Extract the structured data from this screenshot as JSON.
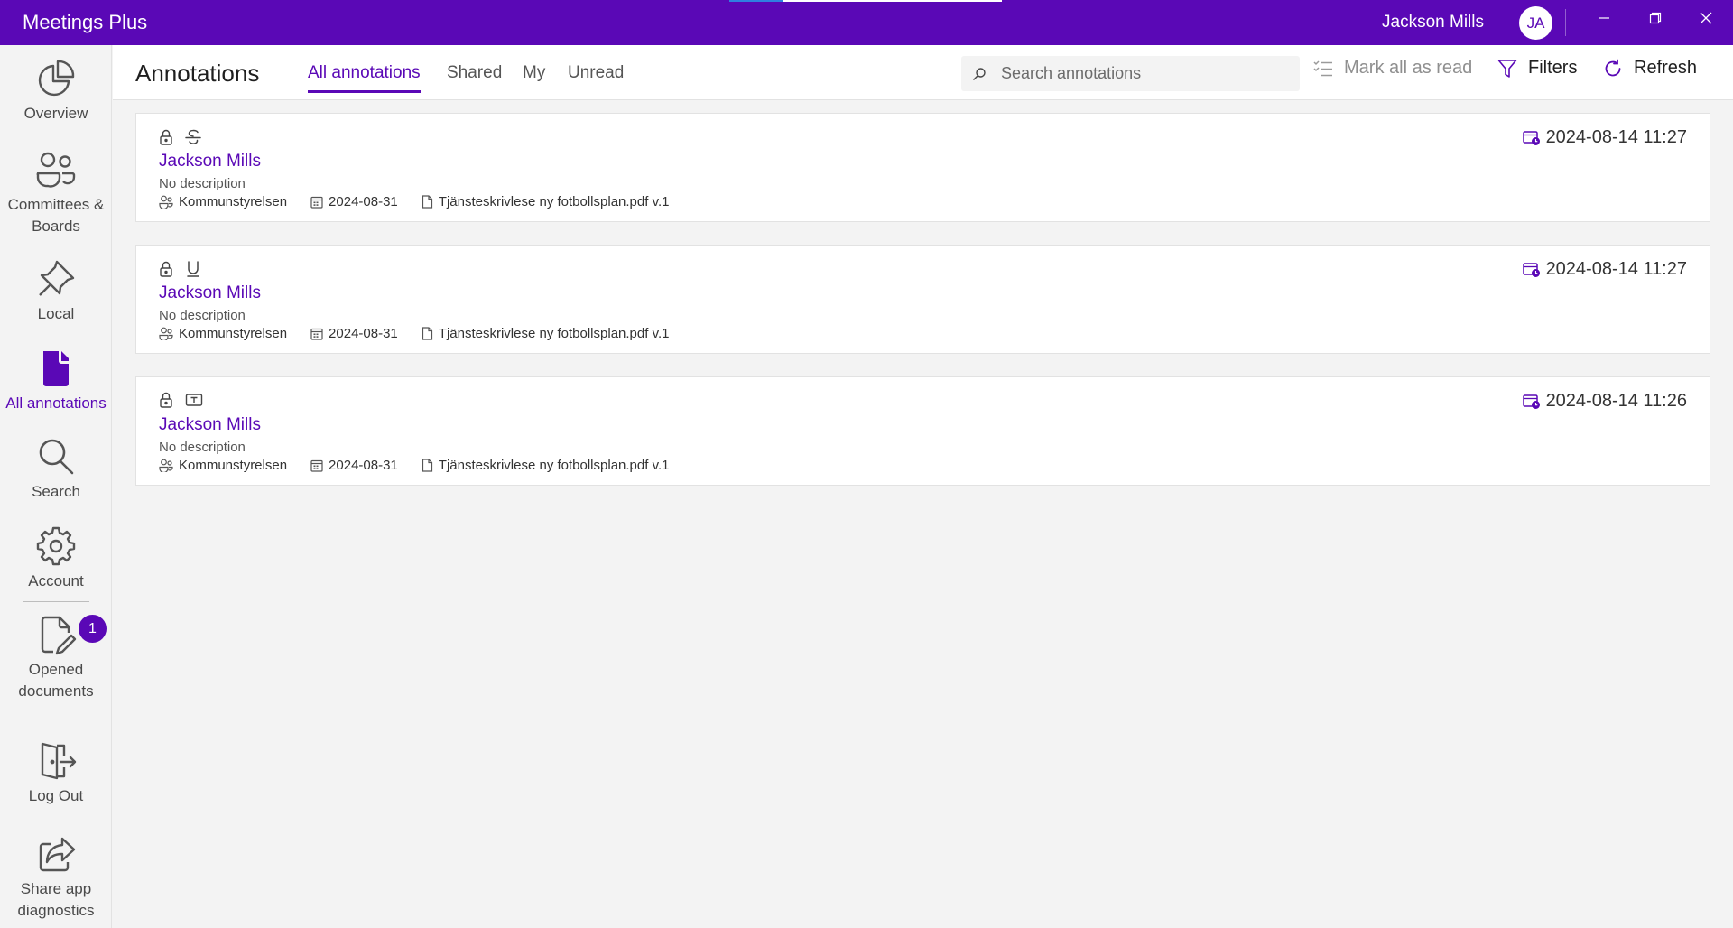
{
  "app": {
    "title": "Meetings Plus"
  },
  "user": {
    "name": "Jackson Mills",
    "initials": "JA"
  },
  "colors": {
    "accent": "#5a08b6",
    "background": "#f3f3f3",
    "card": "#ffffff"
  },
  "sidebar": {
    "items": [
      {
        "label": "Overview",
        "icon": "pie-chart-icon"
      },
      {
        "label": "Committees & Boards",
        "icon": "people-icon"
      },
      {
        "label": "Local",
        "icon": "pin-icon"
      },
      {
        "label": "All annotations",
        "icon": "document-icon",
        "active": true
      },
      {
        "label": "Search",
        "icon": "search-icon"
      },
      {
        "label": "Account",
        "icon": "gear-icon"
      },
      {
        "label": "Opened documents",
        "icon": "document-edit-icon",
        "badge": "1"
      },
      {
        "label": "Log Out",
        "icon": "logout-icon"
      },
      {
        "label": "Share app diagnostics",
        "icon": "share-icon"
      }
    ]
  },
  "header": {
    "title": "Annotations",
    "tabs": [
      {
        "label": "All annotations",
        "active": true
      },
      {
        "label": "Shared"
      },
      {
        "label": "My"
      },
      {
        "label": "Unread"
      }
    ],
    "search_placeholder": "Search annotations",
    "mark_all_label": "Mark all as read",
    "filters_label": "Filters",
    "refresh_label": "Refresh"
  },
  "annotations": [
    {
      "type_icon": "strikethrough-icon",
      "author": "Jackson Mills",
      "description": "No description",
      "committee": "Kommunstyrelsen",
      "meeting_date": "2024-08-31",
      "document": "Tjänsteskrivlese ny fotbollsplan.pdf v.1",
      "timestamp": "2024-08-14 11:27"
    },
    {
      "type_icon": "underline-icon",
      "author": "Jackson Mills",
      "description": "No description",
      "committee": "Kommunstyrelsen",
      "meeting_date": "2024-08-31",
      "document": "Tjänsteskrivlese ny fotbollsplan.pdf v.1",
      "timestamp": "2024-08-14 11:27"
    },
    {
      "type_icon": "text-box-icon",
      "author": "Jackson Mills",
      "description": "No description",
      "committee": "Kommunstyrelsen",
      "meeting_date": "2024-08-31",
      "document": "Tjänsteskrivlese ny fotbollsplan.pdf v.1",
      "timestamp": "2024-08-14 11:26"
    }
  ]
}
